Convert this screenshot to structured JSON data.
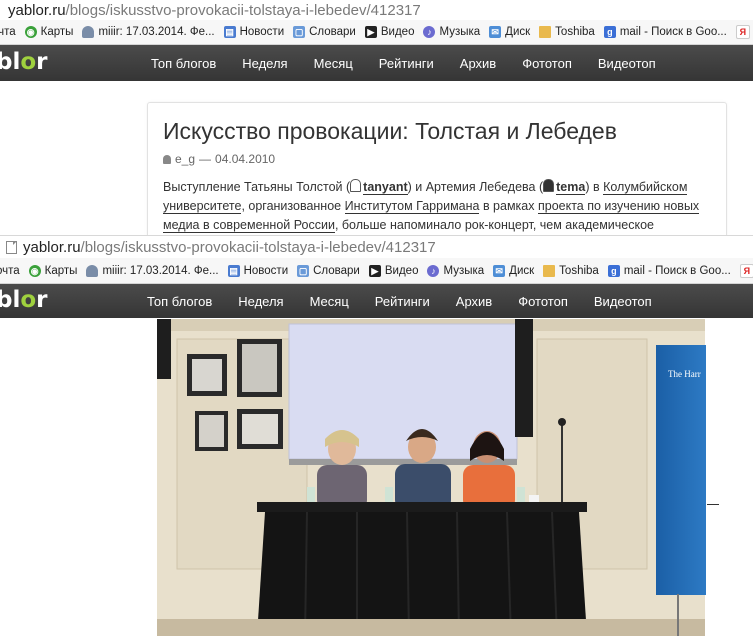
{
  "browser": {
    "url_host": "yablor.ru",
    "url_path": "/blogs/iskusstvo-provokacii-tolstaya-i-lebedev/412317",
    "bookmarks": [
      {
        "label": "очта",
        "icon": "none-icon"
      },
      {
        "label": "Карты",
        "icon": "maps-icon"
      },
      {
        "label": "miiir: 17.03.2014. Фе...",
        "icon": "person-icon"
      },
      {
        "label": "Новости",
        "icon": "news-icon"
      },
      {
        "label": "Словари",
        "icon": "dictionary-icon"
      },
      {
        "label": "Видео",
        "icon": "video-icon"
      },
      {
        "label": "Музыка",
        "icon": "music-icon"
      },
      {
        "label": "Диск",
        "icon": "disk-icon"
      },
      {
        "label": "Toshiba",
        "icon": "folder-icon"
      },
      {
        "label": "mail - Поиск в Goo...",
        "icon": "google-icon"
      },
      {
        "label": "Я",
        "icon": "yandex-icon"
      }
    ]
  },
  "site": {
    "logo_prefix": "b",
    "logo_o": "l",
    "logo_main": "o",
    "logo_suffix": "r",
    "menu": [
      "Топ блогов",
      "Неделя",
      "Месяц",
      "Рейтинги",
      "Архив",
      "Фототоп",
      "Видеотоп"
    ]
  },
  "post": {
    "title": "Искусство провокации: Толстая и Лебедев",
    "author": "e_g",
    "date_sep": "—",
    "date": "04.04.2010",
    "text_1": "Выступление Татьяны Толстой (",
    "user_1": "tanyant",
    "text_2": ") и Артемия Лебедева (",
    "user_2": "tema",
    "text_3": ") в ",
    "link_1": "Колумбийском университете",
    "text_4": ", организованное ",
    "link_2": "Институтом Гарримана",
    "text_5": " в рамках ",
    "link_3": "проекта по изучению новых медиа в современной России",
    "text_6": ", больше напоминало рок-концерт, чем академическое"
  },
  "photo": {
    "banner_text": "The Harr"
  },
  "colors": {
    "navbar": "#3e3e3e",
    "logo_accent": "#9fd13e",
    "screen": "#d9dcf2",
    "tablecloth": "#141414"
  }
}
